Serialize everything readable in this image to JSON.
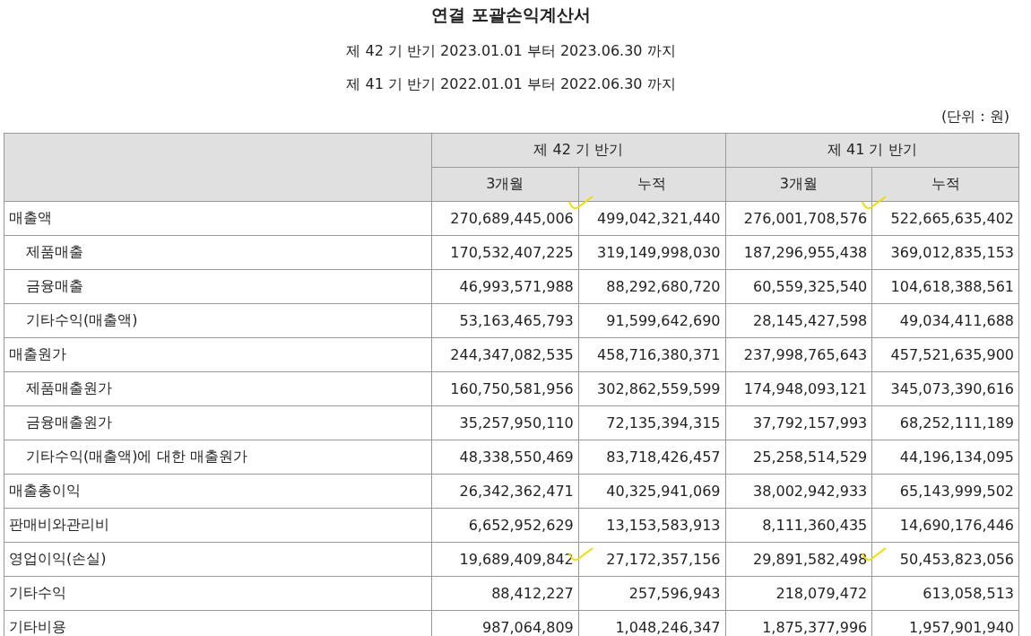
{
  "title": "연결 포괄손익계산서",
  "periods": [
    "제 42 기 반기 2023.01.01 부터 2023.06.30 까지",
    "제 41 기 반기 2022.01.01 부터 2022.06.30 까지"
  ],
  "unit": "(단위 : 원)",
  "table": {
    "groups": [
      "제 42 기 반기",
      "제 41 기 반기"
    ],
    "columns": [
      "3개월",
      "누적",
      "3개월",
      "누적"
    ],
    "rows": [
      {
        "label": "매출액",
        "indented": false,
        "values": [
          "270,689,445,006",
          "499,042,321,440",
          "276,001,708,576",
          "522,665,635,402"
        ],
        "ticked": true
      },
      {
        "label": "제품매출",
        "indented": true,
        "values": [
          "170,532,407,225",
          "319,149,998,030",
          "187,296,955,438",
          "369,012,835,153"
        ],
        "ticked": false
      },
      {
        "label": "금융매출",
        "indented": true,
        "values": [
          "46,993,571,988",
          "88,292,680,720",
          "60,559,325,540",
          "104,618,388,561"
        ],
        "ticked": false
      },
      {
        "label": "기타수익(매출액)",
        "indented": true,
        "values": [
          "53,163,465,793",
          "91,599,642,690",
          "28,145,427,598",
          "49,034,411,688"
        ],
        "ticked": false
      },
      {
        "label": "매출원가",
        "indented": false,
        "values": [
          "244,347,082,535",
          "458,716,380,371",
          "237,998,765,643",
          "457,521,635,900"
        ],
        "ticked": false
      },
      {
        "label": "제품매출원가",
        "indented": true,
        "values": [
          "160,750,581,956",
          "302,862,559,599",
          "174,948,093,121",
          "345,073,390,616"
        ],
        "ticked": false
      },
      {
        "label": "금융매출원가",
        "indented": true,
        "values": [
          "35,257,950,110",
          "72,135,394,315",
          "37,792,157,993",
          "68,252,111,189"
        ],
        "ticked": false
      },
      {
        "label": "기타수익(매출액)에 대한 매출원가",
        "indented": true,
        "values": [
          "48,338,550,469",
          "83,718,426,457",
          "25,258,514,529",
          "44,196,134,095"
        ],
        "ticked": false
      },
      {
        "label": "매출총이익",
        "indented": false,
        "values": [
          "26,342,362,471",
          "40,325,941,069",
          "38,002,942,933",
          "65,143,999,502"
        ],
        "ticked": false
      },
      {
        "label": "판매비와관리비",
        "indented": false,
        "values": [
          "6,652,952,629",
          "13,153,583,913",
          "8,111,360,435",
          "14,690,176,446"
        ],
        "ticked": false
      },
      {
        "label": "영업이익(손실)",
        "indented": false,
        "values": [
          "19,689,409,842",
          "27,172,357,156",
          "29,891,582,498",
          "50,453,823,056"
        ],
        "ticked": true
      },
      {
        "label": "기타수익",
        "indented": false,
        "values": [
          "88,412,227",
          "257,596,943",
          "218,079,472",
          "613,058,513"
        ],
        "ticked": false
      },
      {
        "label": "기타비용",
        "indented": false,
        "values": [
          "987,064,809",
          "1,048,246,347",
          "1,875,377,996",
          "1,957,901,940"
        ],
        "ticked": false
      }
    ]
  }
}
